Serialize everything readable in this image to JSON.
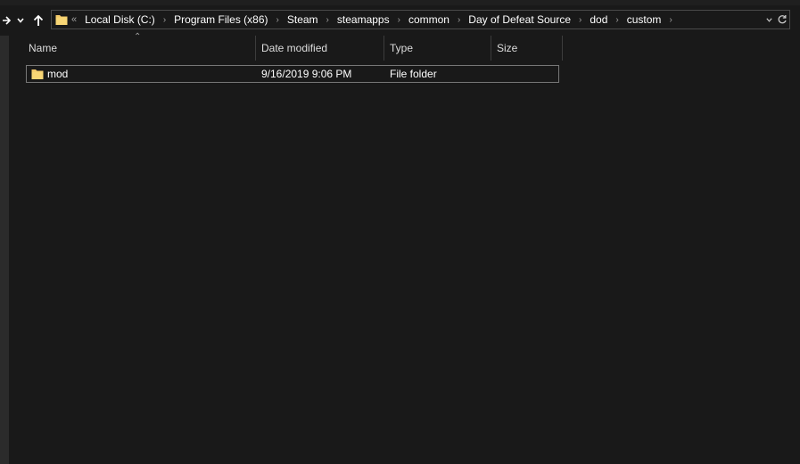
{
  "navigation": {
    "forward_icon": "arrow-right-icon",
    "recent_icon": "chevron-down-icon",
    "up_icon": "arrow-up-icon"
  },
  "address_bar": {
    "overflow": "«",
    "breadcrumbs": [
      "Local Disk (C:)",
      "Program Files (x86)",
      "Steam",
      "steamapps",
      "common",
      "Day of Defeat Source",
      "dod",
      "custom"
    ],
    "refresh_icon": "refresh-icon"
  },
  "columns": {
    "name": "Name",
    "date_modified": "Date modified",
    "type": "Type",
    "size": "Size"
  },
  "files": [
    {
      "name": "mod",
      "date_modified": "9/16/2019 9:06 PM",
      "type": "File folder",
      "size": "",
      "icon": "folder-icon"
    }
  ],
  "colors": {
    "background": "#191919",
    "folder": "#f3c969"
  }
}
